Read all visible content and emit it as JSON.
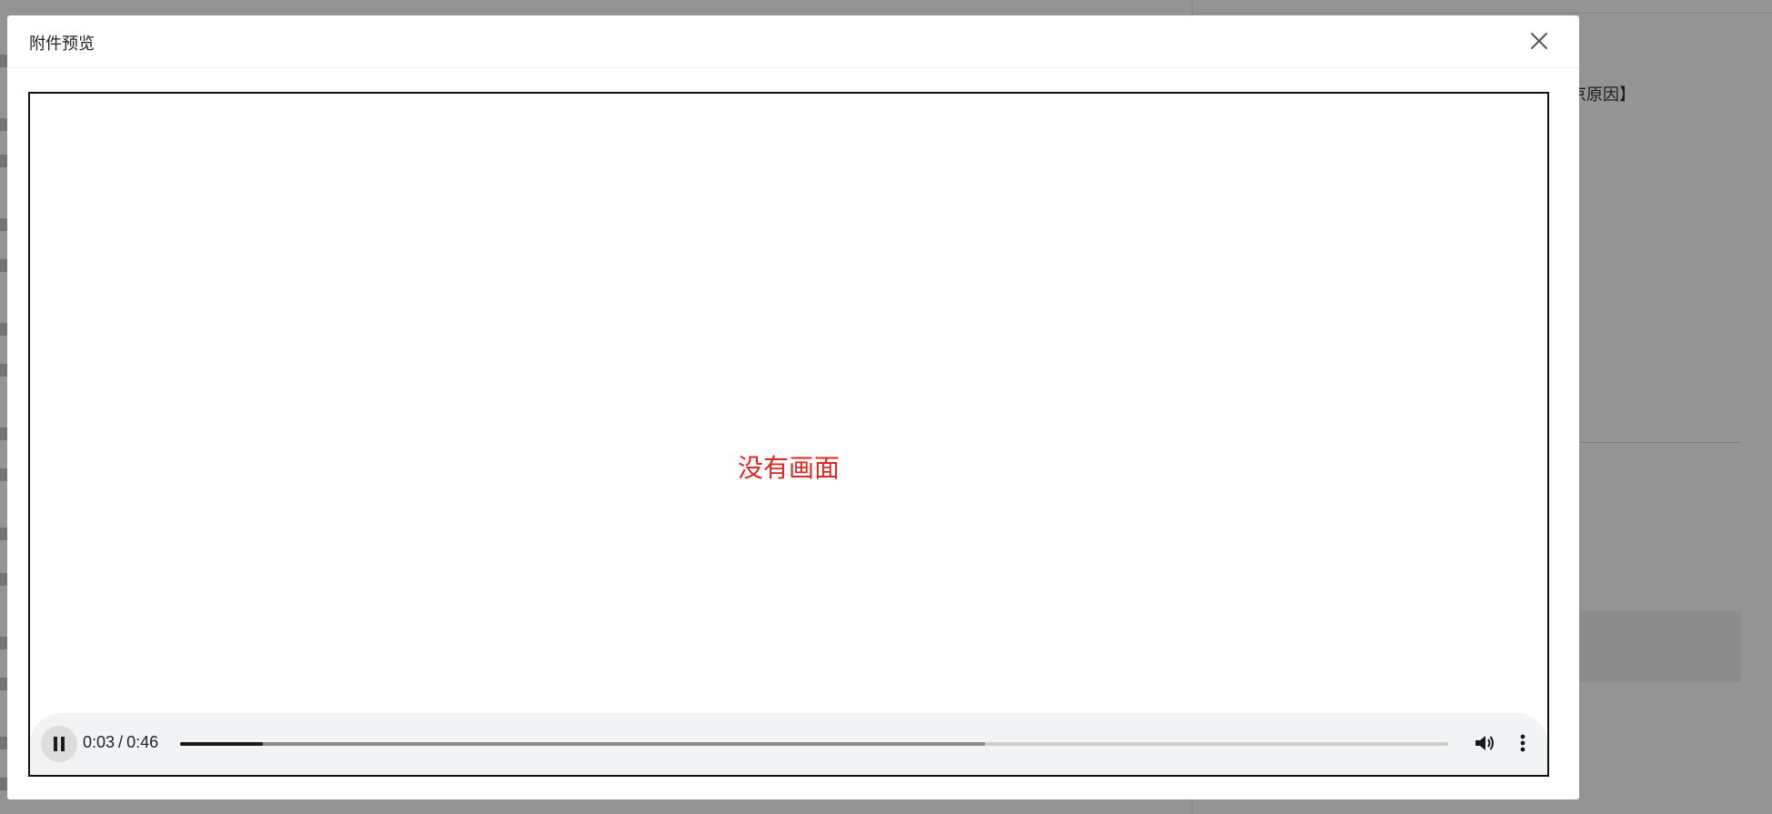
{
  "background": {
    "reason_fragment": "京原因】"
  },
  "dialog": {
    "title": "附件预览",
    "close_icon": "close-icon"
  },
  "player": {
    "no_picture_text": "没有画面",
    "current_time": "0:03",
    "separator": "/",
    "duration": "0:46",
    "progress_played_fraction": 0.0652,
    "progress_buffered_fraction": 0.635,
    "icons": {
      "pause": "pause-icon",
      "volume": "volume-icon",
      "more": "more-vert-icon"
    },
    "colors": {
      "no_picture_text": "#e0281e",
      "controls_bg": "#f1f3f4"
    }
  }
}
